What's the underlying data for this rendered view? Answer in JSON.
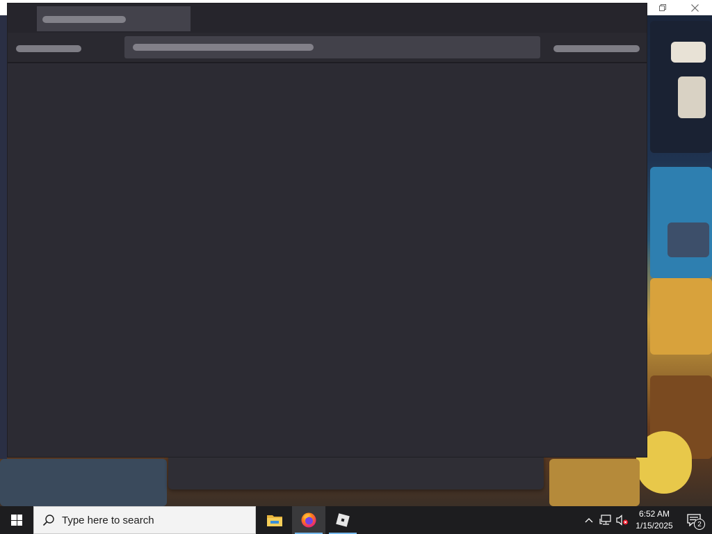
{
  "taskbar": {
    "search_placeholder": "Type here to search",
    "clock": {
      "time": "6:52 AM",
      "date": "1/15/2025"
    },
    "notification_count": "2",
    "pinned_apps": [
      "file-explorer",
      "firefox",
      "roblox"
    ],
    "active_app": "firefox"
  },
  "window": {
    "state": "loading",
    "colors": {
      "background": "#2c2b33",
      "tab": "#43424b",
      "skeleton": "#8d8c94"
    }
  },
  "icons": {
    "start": "windows-logo-icon",
    "search": "search-icon",
    "tray": [
      "chevron-up-icon",
      "network-icon",
      "volume-muted-icon"
    ],
    "notifications": "action-center-icon"
  }
}
